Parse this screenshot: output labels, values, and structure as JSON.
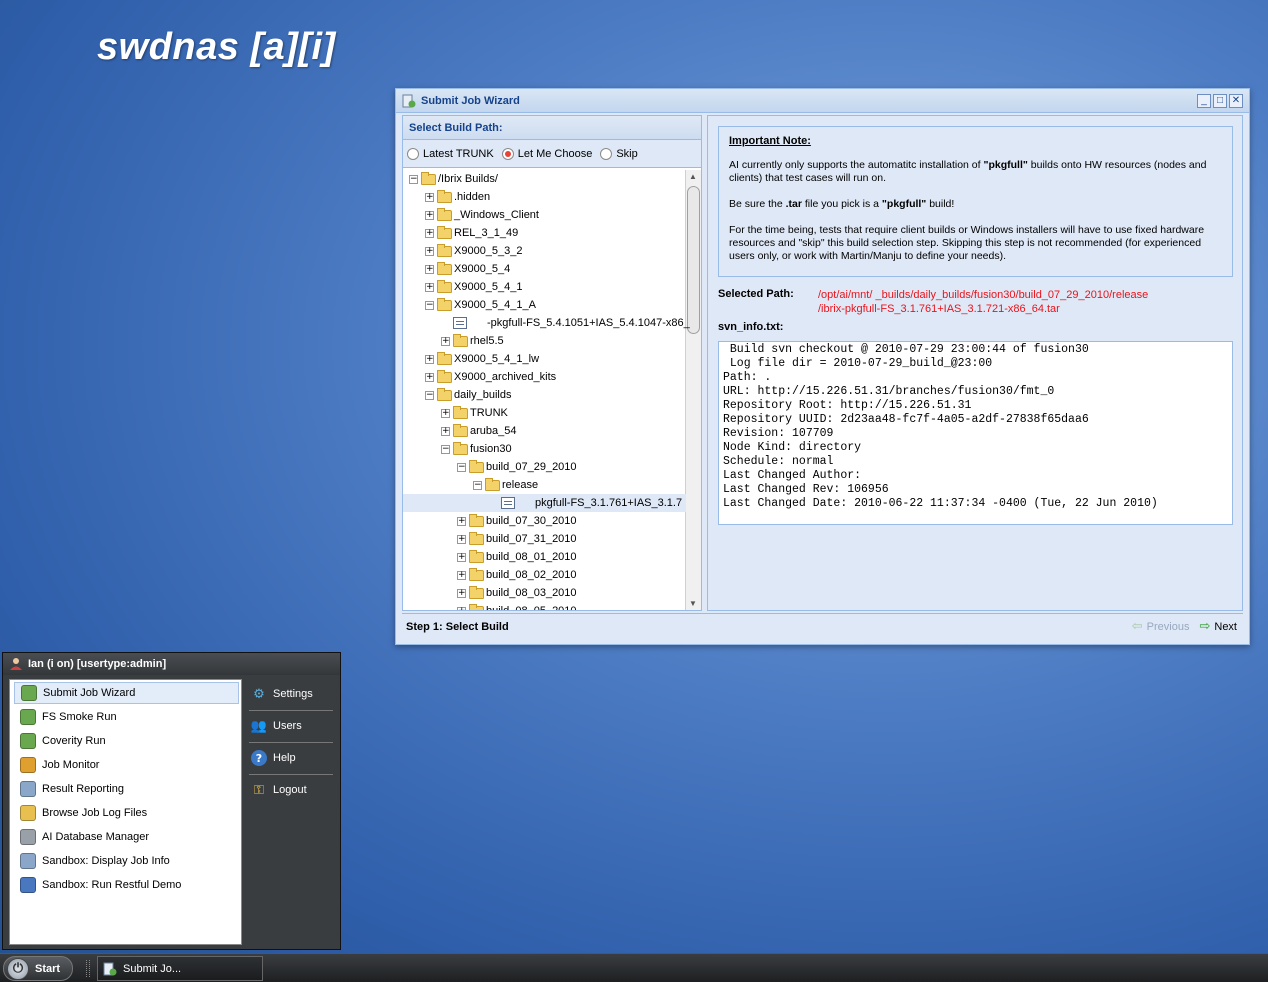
{
  "brand": "swdnas [a][i]",
  "window": {
    "title": "Submit Job Wizard",
    "tools": [
      "_",
      "□",
      "✕"
    ],
    "left_panel": {
      "title": "Select Build Path:",
      "radios": [
        {
          "label": "Latest TRUNK",
          "checked": false
        },
        {
          "label": "Let Me Choose",
          "checked": true
        },
        {
          "label": "Skip",
          "checked": false
        }
      ],
      "tree": [
        {
          "label": "/Ibrix Builds/",
          "depth": 0,
          "type": "folder",
          "expander": "⊟"
        },
        {
          "label": ".hidden",
          "depth": 1,
          "type": "folder",
          "expander": "⊞"
        },
        {
          "label": "_Windows_Client",
          "depth": 1,
          "type": "folder",
          "expander": "⊞"
        },
        {
          "label": "REL_3_1_49",
          "depth": 1,
          "type": "folder",
          "expander": "⊞"
        },
        {
          "label": "X9000_5_3_2",
          "depth": 1,
          "type": "folder",
          "expander": "⊞"
        },
        {
          "label": "X9000_5_4",
          "depth": 1,
          "type": "folder",
          "expander": "⊞"
        },
        {
          "label": "X9000_5_4_1",
          "depth": 1,
          "type": "folder",
          "expander": "⊞"
        },
        {
          "label": "X9000_5_4_1_A",
          "depth": 1,
          "type": "folder",
          "expander": "⊟"
        },
        {
          "label": "-pkgfull-FS_5.4.1051+IAS_5.4.1047-x86_",
          "depth": 2,
          "type": "file",
          "expander": ""
        },
        {
          "label": "rhel5.5",
          "depth": 2,
          "type": "folder",
          "expander": "⊞"
        },
        {
          "label": "X9000_5_4_1_lw",
          "depth": 1,
          "type": "folder",
          "expander": "⊞"
        },
        {
          "label": "X9000_archived_kits",
          "depth": 1,
          "type": "folder",
          "expander": "⊞"
        },
        {
          "label": "daily_builds",
          "depth": 1,
          "type": "folder",
          "expander": "⊟"
        },
        {
          "label": "TRUNK",
          "depth": 2,
          "type": "folder",
          "expander": "⊞"
        },
        {
          "label": "aruba_54",
          "depth": 2,
          "type": "folder",
          "expander": "⊞"
        },
        {
          "label": "fusion30",
          "depth": 2,
          "type": "folder",
          "expander": "⊟"
        },
        {
          "label": "build_07_29_2010",
          "depth": 3,
          "type": "folder",
          "expander": "⊟"
        },
        {
          "label": "release",
          "depth": 4,
          "type": "folder",
          "expander": "⊟"
        },
        {
          "label": "pkgfull-FS_3.1.761+IAS_3.1.7",
          "depth": 5,
          "type": "file",
          "expander": "",
          "selected": true
        },
        {
          "label": "build_07_30_2010",
          "depth": 3,
          "type": "folder",
          "expander": "⊞"
        },
        {
          "label": "build_07_31_2010",
          "depth": 3,
          "type": "folder",
          "expander": "⊞"
        },
        {
          "label": "build_08_01_2010",
          "depth": 3,
          "type": "folder",
          "expander": "⊞"
        },
        {
          "label": "build_08_02_2010",
          "depth": 3,
          "type": "folder",
          "expander": "⊞"
        },
        {
          "label": "build_08_03_2010",
          "depth": 3,
          "type": "folder",
          "expander": "⊞"
        },
        {
          "label": "build_08_05_2010",
          "depth": 3,
          "type": "folder",
          "expander": "⊞"
        }
      ]
    },
    "right_panel": {
      "note_title": "Important Note:",
      "note_p1": "AI currently only supports the automatitc installation of \"pkgfull\" builds onto HW resources (nodes and clients) that test cases will run on.",
      "note_p2": "Be sure the .tar file you pick is a \"pkgfull\" build!",
      "note_p3": "For the time being, tests that require client builds or Windows installers will have to use fixed hardware resources and \"skip\" this build selection step. Skipping this step is not recommended (for experienced users only, or work with Martin/Manju to define your needs).",
      "selected_label": "Selected Path:",
      "selected_path_1": "/opt/ai/mnt/      _builds/daily_builds/fusion30/build_07_29_2010/release",
      "selected_path_2": "/ibrix-pkgfull-FS_3.1.761+IAS_3.1.721-x86_64.tar",
      "svn_label": "svn_info.txt:",
      "svn_lines": [
        " Build svn checkout @ 2010-07-29 23:00:44 of fusion30",
        " Log file dir = 2010-07-29_build_@23:00",
        "Path: .",
        "URL: http://15.226.51.31/branches/fusion30/fmt_0",
        "Repository Root: http://15.226.51.31",
        "Repository UUID: 2d23aa48-fc7f-4a05-a2df-27838f65daa6",
        "Revision: 107709",
        "Node Kind: directory",
        "Schedule: normal",
        "Last Changed Author:",
        "Last Changed Rev: 106956",
        "Last Changed Date: 2010-06-22 11:37:34 -0400 (Tue, 22 Jun 2010)"
      ]
    },
    "footer": {
      "step": "Step 1: Select Build",
      "previous": "Previous",
      "next": "Next"
    }
  },
  "start_menu": {
    "user": "Ian (i          on) [usertype:admin]",
    "items": [
      {
        "label": "Submit Job Wizard",
        "icon": "wizard-icon",
        "color": "#6aa84f"
      },
      {
        "label": "FS Smoke Run",
        "icon": "smoke-run-icon",
        "color": "#6aa84f"
      },
      {
        "label": "Coverity Run",
        "icon": "coverity-icon",
        "color": "#6aa84f"
      },
      {
        "label": "Job Monitor",
        "icon": "monitor-icon",
        "color": "#e0a030"
      },
      {
        "label": "Result Reporting",
        "icon": "report-icon",
        "color": "#8aa6c8"
      },
      {
        "label": "Browse Job Log Files",
        "icon": "folder-search-icon",
        "color": "#e8c050"
      },
      {
        "label": "AI Database Manager",
        "icon": "database-icon",
        "color": "#9aa0a8"
      },
      {
        "label": "Sandbox: Display Job Info",
        "icon": "grid-icon",
        "color": "#8aa6c8"
      },
      {
        "label": "Sandbox: Run Restful Demo",
        "icon": "list-icon",
        "color": "#4a78c0"
      }
    ],
    "right_items": [
      {
        "label": "Settings",
        "icon": "gear-icon",
        "glyph": "⚙",
        "color": "#58b0e0"
      },
      {
        "label": "Users",
        "icon": "users-icon",
        "glyph": "👥",
        "color": "#e8b060"
      },
      {
        "label": "Help",
        "icon": "help-icon",
        "glyph": "?",
        "color": "#3a78c8"
      },
      {
        "label": "Logout",
        "icon": "key-icon",
        "glyph": "⚿",
        "color": "#e8c050"
      }
    ]
  },
  "taskbar": {
    "start": "Start",
    "task": "Submit Jo..."
  }
}
